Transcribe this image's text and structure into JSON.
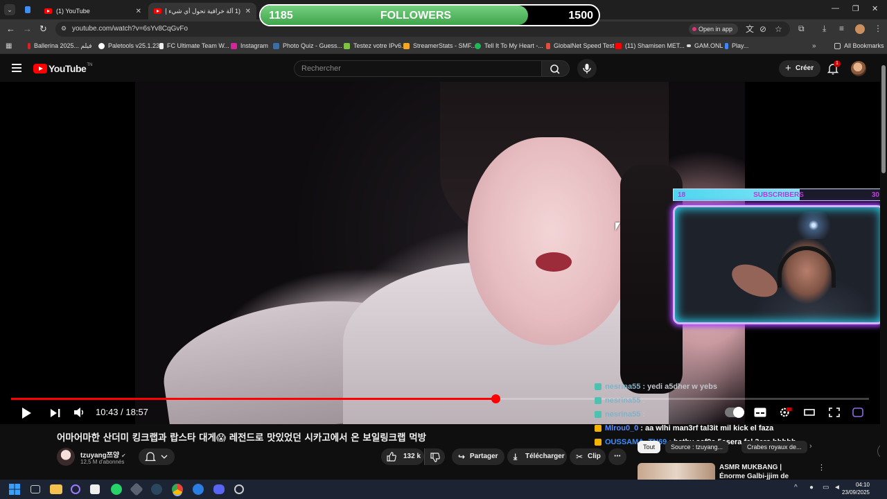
{
  "browser": {
    "tabs": [
      {
        "label": "(1) YouTube"
      },
      {
        "label": "(1 آلة خرافية تحول أي شيء إلى ..."
      }
    ],
    "url": "youtube.com/watch?v=6sYv8CqGvFo",
    "open_in_app": "Open in app",
    "bookmarks": [
      {
        "label": "Ballerina 2025... فيلم",
        "color": "#e02020"
      },
      {
        "label": "Paletools v25.1.23",
        "color": "#ffffff"
      },
      {
        "label": "FC Ultimate Team W...",
        "color": "#eeeeee"
      },
      {
        "label": "Instagram",
        "color": "#d6249f"
      },
      {
        "label": "Photo Quiz - Guess...",
        "color": "#3a6ea5"
      },
      {
        "label": "Testez votre IPv6.",
        "color": "#7dc242"
      },
      {
        "label": "StreamerStats - SMF...",
        "color": "#f5a623"
      },
      {
        "label": "Tell It To My Heart -...",
        "color": "#1db954"
      },
      {
        "label": "GlobalNet Speed Test",
        "color": "#e74c3c"
      },
      {
        "label": "(11) Shamisen MET...",
        "color": "#ff0000"
      },
      {
        "label": "GAM.ONL",
        "color": "#dddddd"
      },
      {
        "label": "Play...",
        "color": "#4285f4"
      }
    ],
    "all_bookmarks": "All Bookmarks"
  },
  "youtube": {
    "logo_word": "YouTube",
    "logo_region": "TN",
    "search_placeholder": "Rechercher",
    "create_label": "Créer",
    "notifications_count": "1"
  },
  "player": {
    "current_time": "10:43",
    "duration": "18:57",
    "timecode": "10:43 / 18:57",
    "progress": 0.565
  },
  "overlay": {
    "followers_current": "1185",
    "followers_label": "FOLLOWERS",
    "followers_goal": "1500",
    "followers_progress": 0.79,
    "subs_current": "18",
    "subs_label": "SUBSCRIBERS",
    "subs_goal": "30",
    "subs_progress": 0.6
  },
  "chat": [
    {
      "user": "nesrina55",
      "msg": ": yedi a5dher w yebs",
      "user_color": "#7fb3c8",
      "badge_color": "#4cc2b0"
    },
    {
      "user": "nesrina55",
      "msg": ":",
      "user_color": "#7fb3c8",
      "badge_color": "#4cc2b0"
    },
    {
      "user": "nesrina55",
      "msg": ":",
      "user_color": "#7fb3c8",
      "badge_color": "#4cc2b0"
    },
    {
      "user": "Mlrou0_0",
      "msg": ": aa wlhi man3rf tal3it mil kick el faza",
      "user_color": "#5b8cff",
      "badge_color": "#f5b301"
    },
    {
      "user": "OUSSAMA_TN69",
      "msg": ": hathy saf9a 5asera fel 3ers hhhhh",
      "user_color": "#3b8fff",
      "badge_color": "#f5b301"
    }
  ],
  "video": {
    "title": "어마어마한 산더미 킹크랩과 랍스타 대게😱 레전드로 맛있었던 시카고에서 온 보일링크랩 먹방",
    "channel_name": "tzuyang쯔양",
    "channel_subs": "12,5 M d'abonnés",
    "likes": "132 k",
    "share": "Partager",
    "download": "Télécharger",
    "clip": "Clip"
  },
  "sidebar": {
    "chips": [
      {
        "label": "Tout"
      },
      {
        "label": "Source : tzuyang..."
      },
      {
        "label": "Crabes royaux de..."
      }
    ],
    "reco_title": "ASMR MUKBANG | Énorme Galbi-jjim de boeuf, saucisse..."
  },
  "taskbar": {
    "time": "04:10",
    "date": "23/09/2025"
  }
}
